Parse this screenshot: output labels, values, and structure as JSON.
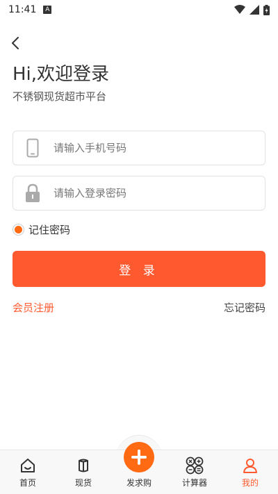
{
  "status_bar": {
    "time": "11:41",
    "notification_letter": "A"
  },
  "greeting": "Hi,欢迎登录",
  "subtitle": "不锈钢现货超市平台",
  "form": {
    "phone_placeholder": "请输入手机号码",
    "password_placeholder": "请输入登录密码",
    "remember_label": "记住密码",
    "remember_checked": true,
    "login_label": "登 录",
    "register_label": "会员注册",
    "forgot_label": "忘记密码"
  },
  "tabs": [
    {
      "label": "首页",
      "icon": "home-icon",
      "active": false
    },
    {
      "label": "现货",
      "icon": "box-icon",
      "active": false
    },
    {
      "label": "发求购",
      "icon": "plus-icon",
      "active": false
    },
    {
      "label": "计算器",
      "icon": "calculator-icon",
      "active": false
    },
    {
      "label": "我的",
      "icon": "user-icon",
      "active": true
    }
  ],
  "colors": {
    "accent": "#ff5a2f",
    "plus": "#ff6a13"
  }
}
